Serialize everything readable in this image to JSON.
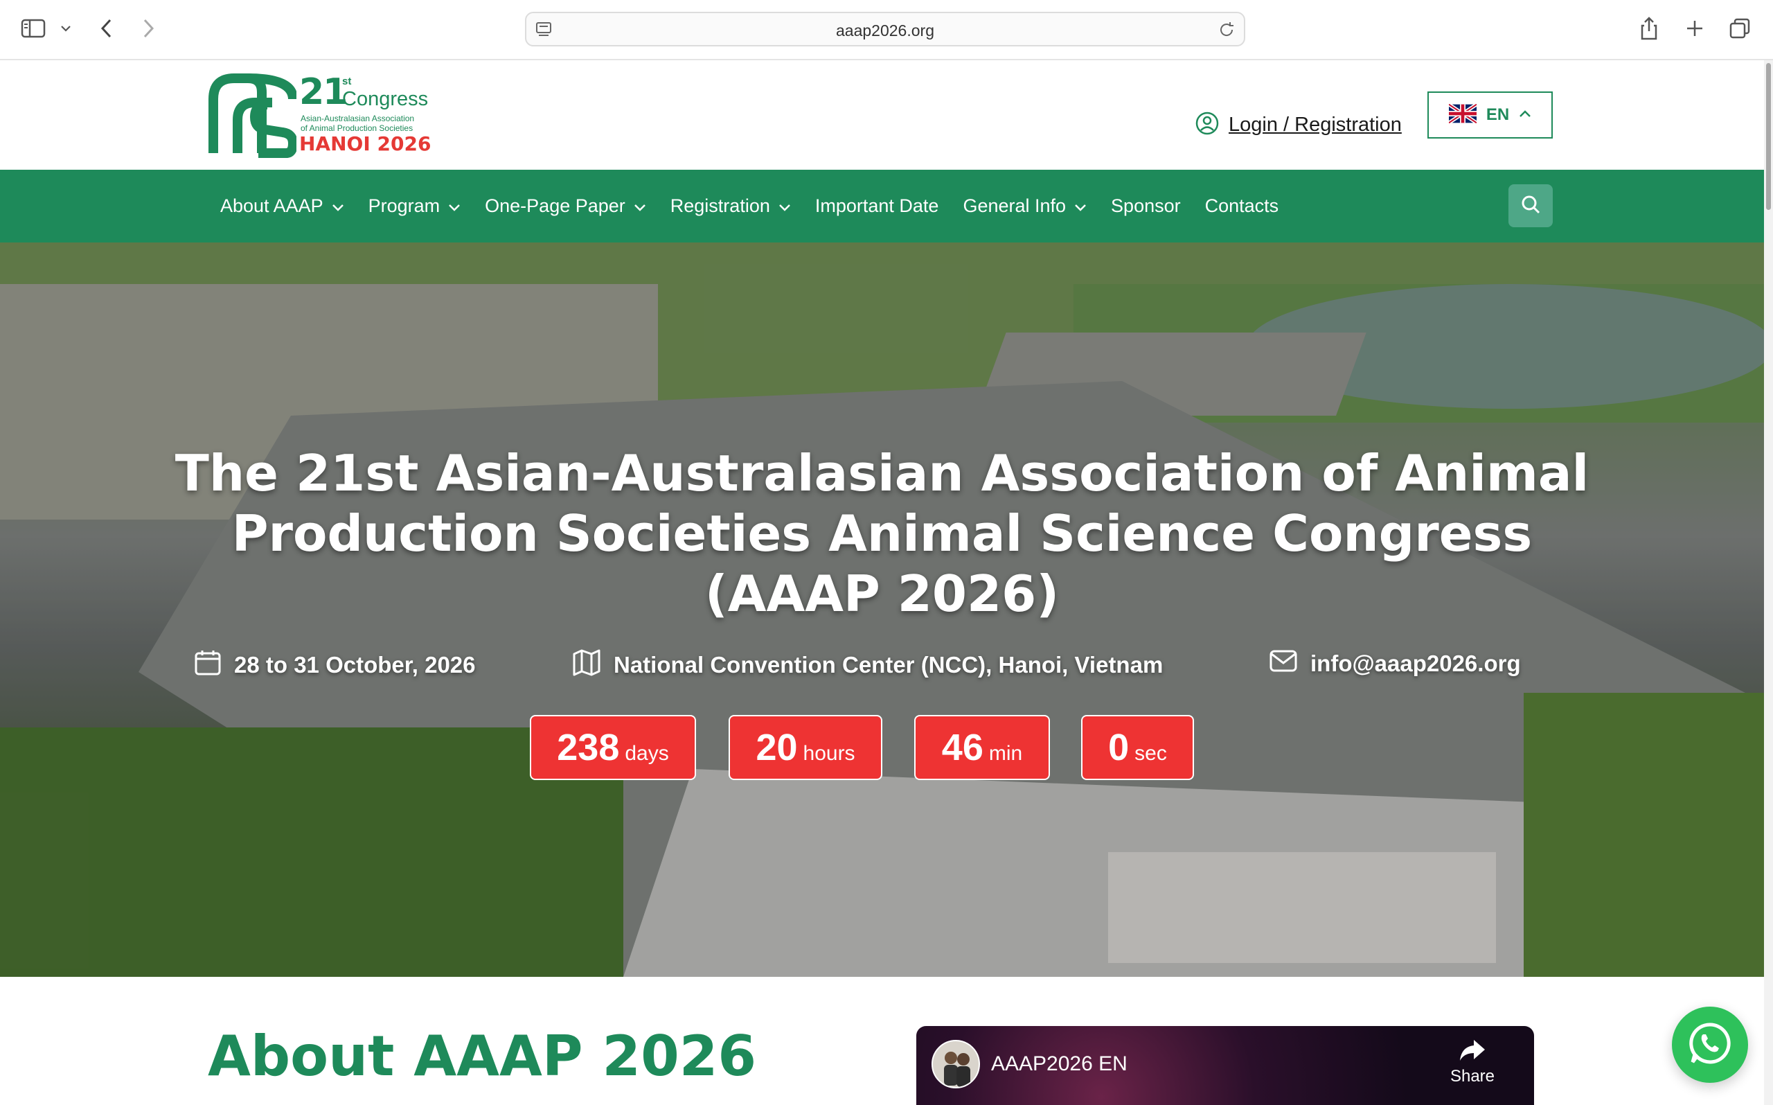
{
  "browser": {
    "url": "aaap2026.org"
  },
  "header": {
    "logo": {
      "number": "21",
      "ordinal": "st",
      "congress": "Congress",
      "assoc_line1": "Asian-Australasian Association",
      "assoc_line2": "of Animal Production Societies",
      "city": "HANOI 2026"
    },
    "login_label": "Login / Registration",
    "language": "EN"
  },
  "nav": {
    "items": [
      {
        "label": "About AAAP",
        "dropdown": true
      },
      {
        "label": "Program",
        "dropdown": true
      },
      {
        "label": "One-Page Paper",
        "dropdown": true
      },
      {
        "label": "Registration",
        "dropdown": true
      },
      {
        "label": "Important Date",
        "dropdown": false
      },
      {
        "label": "General Info",
        "dropdown": true
      },
      {
        "label": "Sponsor",
        "dropdown": false
      },
      {
        "label": "Contacts",
        "dropdown": false
      }
    ]
  },
  "hero": {
    "title_line1": "The 21st Asian-Australasian Association of Animal",
    "title_line2": "Production Societies Animal Science Congress",
    "title_line3": "(AAAP 2026)",
    "date": "28 to 31 October, 2026",
    "venue": "National Convention Center (NCC), Hanoi, Vietnam",
    "email": "info@aaap2026.org",
    "countdown": [
      {
        "value": "238",
        "unit": "days"
      },
      {
        "value": "20",
        "unit": "hours"
      },
      {
        "value": "46",
        "unit": "min"
      },
      {
        "value": "0",
        "unit": "sec"
      }
    ]
  },
  "about": {
    "title": "About AAAP 2026"
  },
  "video": {
    "title": "AAAP2026 EN",
    "share_label": "Share"
  },
  "colors": {
    "brand_green": "#1e8a5a",
    "accent_red": "#ee3333",
    "whatsapp_green": "#2ec15b"
  }
}
